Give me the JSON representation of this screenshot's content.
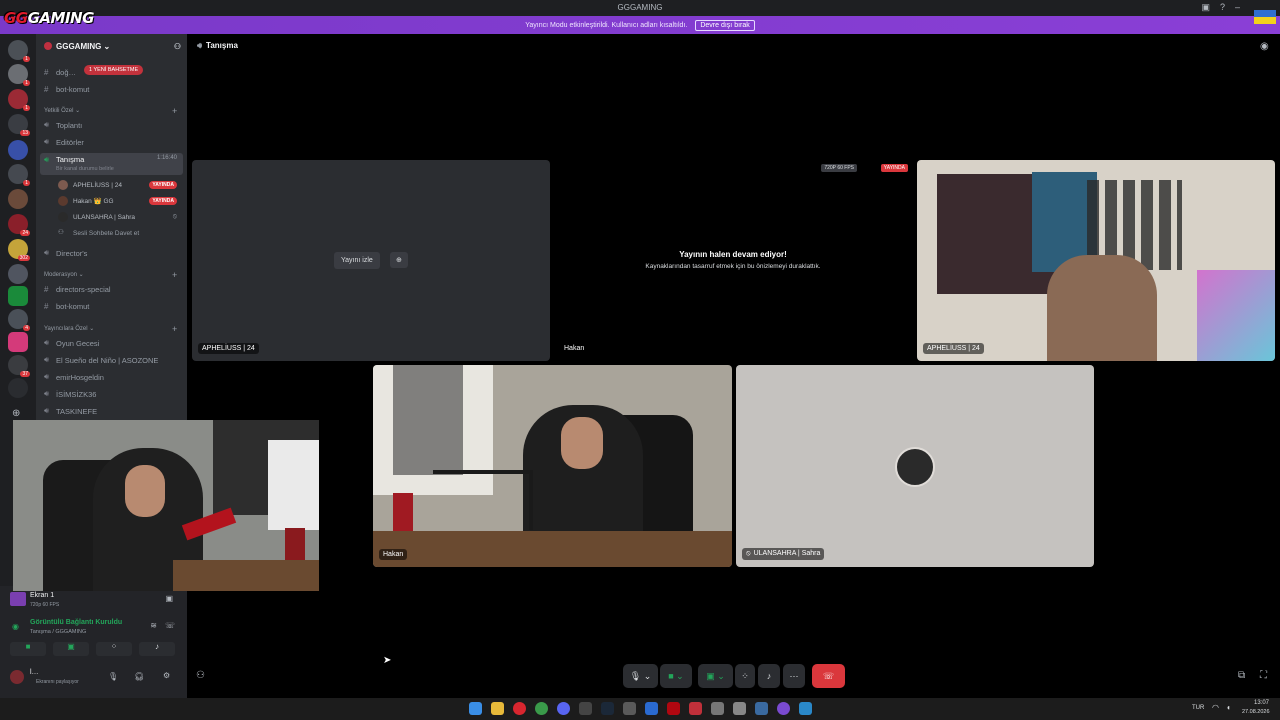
{
  "window": {
    "title": "GGGAMING"
  },
  "logo": {
    "prefix": "GG",
    "suffix": "GAMING"
  },
  "banner": {
    "text": "Yayıncı Modu etkinleştirildi. Kullanıcı adları kısaltıldı.",
    "button": "Devre dışı bırak"
  },
  "guild": {
    "name": "GGGAMING ⌄"
  },
  "sidebar": {
    "new_messages": "1 YENİ BAHSETME",
    "channels_top": [
      {
        "label": "doğ…",
        "sym": "#"
      },
      {
        "label": "bot-komut",
        "sym": "#"
      }
    ],
    "cat_yetkili": "Yetkili Özel ⌄",
    "voice_channels": [
      {
        "label": "Toplantı"
      },
      {
        "label": "Editörler"
      },
      {
        "label": "Tanışma",
        "time": "1:16:40",
        "sub": "Bir kanal durumu belirle"
      }
    ],
    "voice_users": [
      {
        "name": "APHELİUSS | 24",
        "live": "YAYINDA"
      },
      {
        "name": "Hakan 👑 GG",
        "live": "YAYINDA"
      },
      {
        "name": "ULANSAHRA | Sahra"
      },
      {
        "name": "Sesli Sohbete Davet et"
      }
    ],
    "directors": "Director's",
    "cat_moderasyon": "Moderasyon ⌄",
    "mod_channels": [
      {
        "label": "directors-special"
      },
      {
        "label": "bot-komut"
      }
    ],
    "cat_yayincilar": "Yayıncılara Özel ⌄",
    "more_channels": [
      {
        "label": "Oyun Gecesi"
      },
      {
        "label": "El Sueño del Niño | ASOZONE"
      },
      {
        "label": "emirHosgeldin"
      },
      {
        "label": "İSİMSİZK36"
      },
      {
        "label": "TASKINEFE"
      }
    ]
  },
  "panel": {
    "screen_title": "Ekran 1",
    "screen_sub": "720p 60 FPS",
    "connected": "Görüntülü Bağlantı Kuruldu",
    "connected_sub": "Tanışma / GGGAMING",
    "user_name": "l…",
    "user_status": "Ekranını paylaşıyor"
  },
  "main": {
    "channel_title": "Tanışma",
    "watch_button": "Yayını izle",
    "tile1_label": "APHELİUSS | 24",
    "paused_title": "Yayının halen devam ediyor!",
    "paused_sub": "Kaynaklarından tasarruf etmek için bu önizlemeyi duraklattık.",
    "quality_badge": "720P 60 FPS",
    "live_badge": "YAYINDA",
    "tile2_label": "Hakan",
    "tile3_label": "APHELİUSS | 24",
    "tile4_label": "Hakan",
    "tile5_label": "ULANSAHRA | Sahra"
  },
  "taskbar": {
    "lang": "TUR",
    "time": "13:07",
    "date": "27.08.2026"
  },
  "colors": {
    "accent": "#5865f2",
    "live": "#da373c",
    "banner": "#8a3fd6",
    "hangup": "#da373c",
    "green": "#23a55a"
  }
}
